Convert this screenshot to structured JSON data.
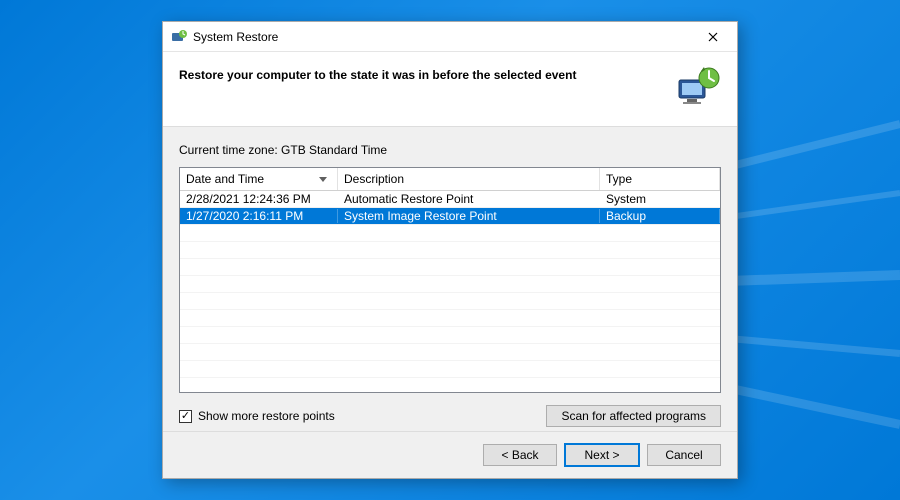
{
  "window": {
    "title": "System Restore"
  },
  "header": {
    "text": "Restore your computer to the state it was in before the selected event"
  },
  "timezone_label": "Current time zone: GTB Standard Time",
  "columns": {
    "date": "Date and Time",
    "desc": "Description",
    "type": "Type"
  },
  "rows": [
    {
      "date": "2/28/2021 12:24:36 PM",
      "desc": "Automatic Restore Point",
      "type": "System",
      "selected": false
    },
    {
      "date": "1/27/2020 2:16:11 PM",
      "desc": "System Image Restore Point",
      "type": "Backup",
      "selected": true
    }
  ],
  "checkbox": {
    "checked": true,
    "label": "Show more restore points"
  },
  "buttons": {
    "scan": "Scan for affected programs",
    "back": "< Back",
    "next": "Next >",
    "cancel": "Cancel"
  }
}
